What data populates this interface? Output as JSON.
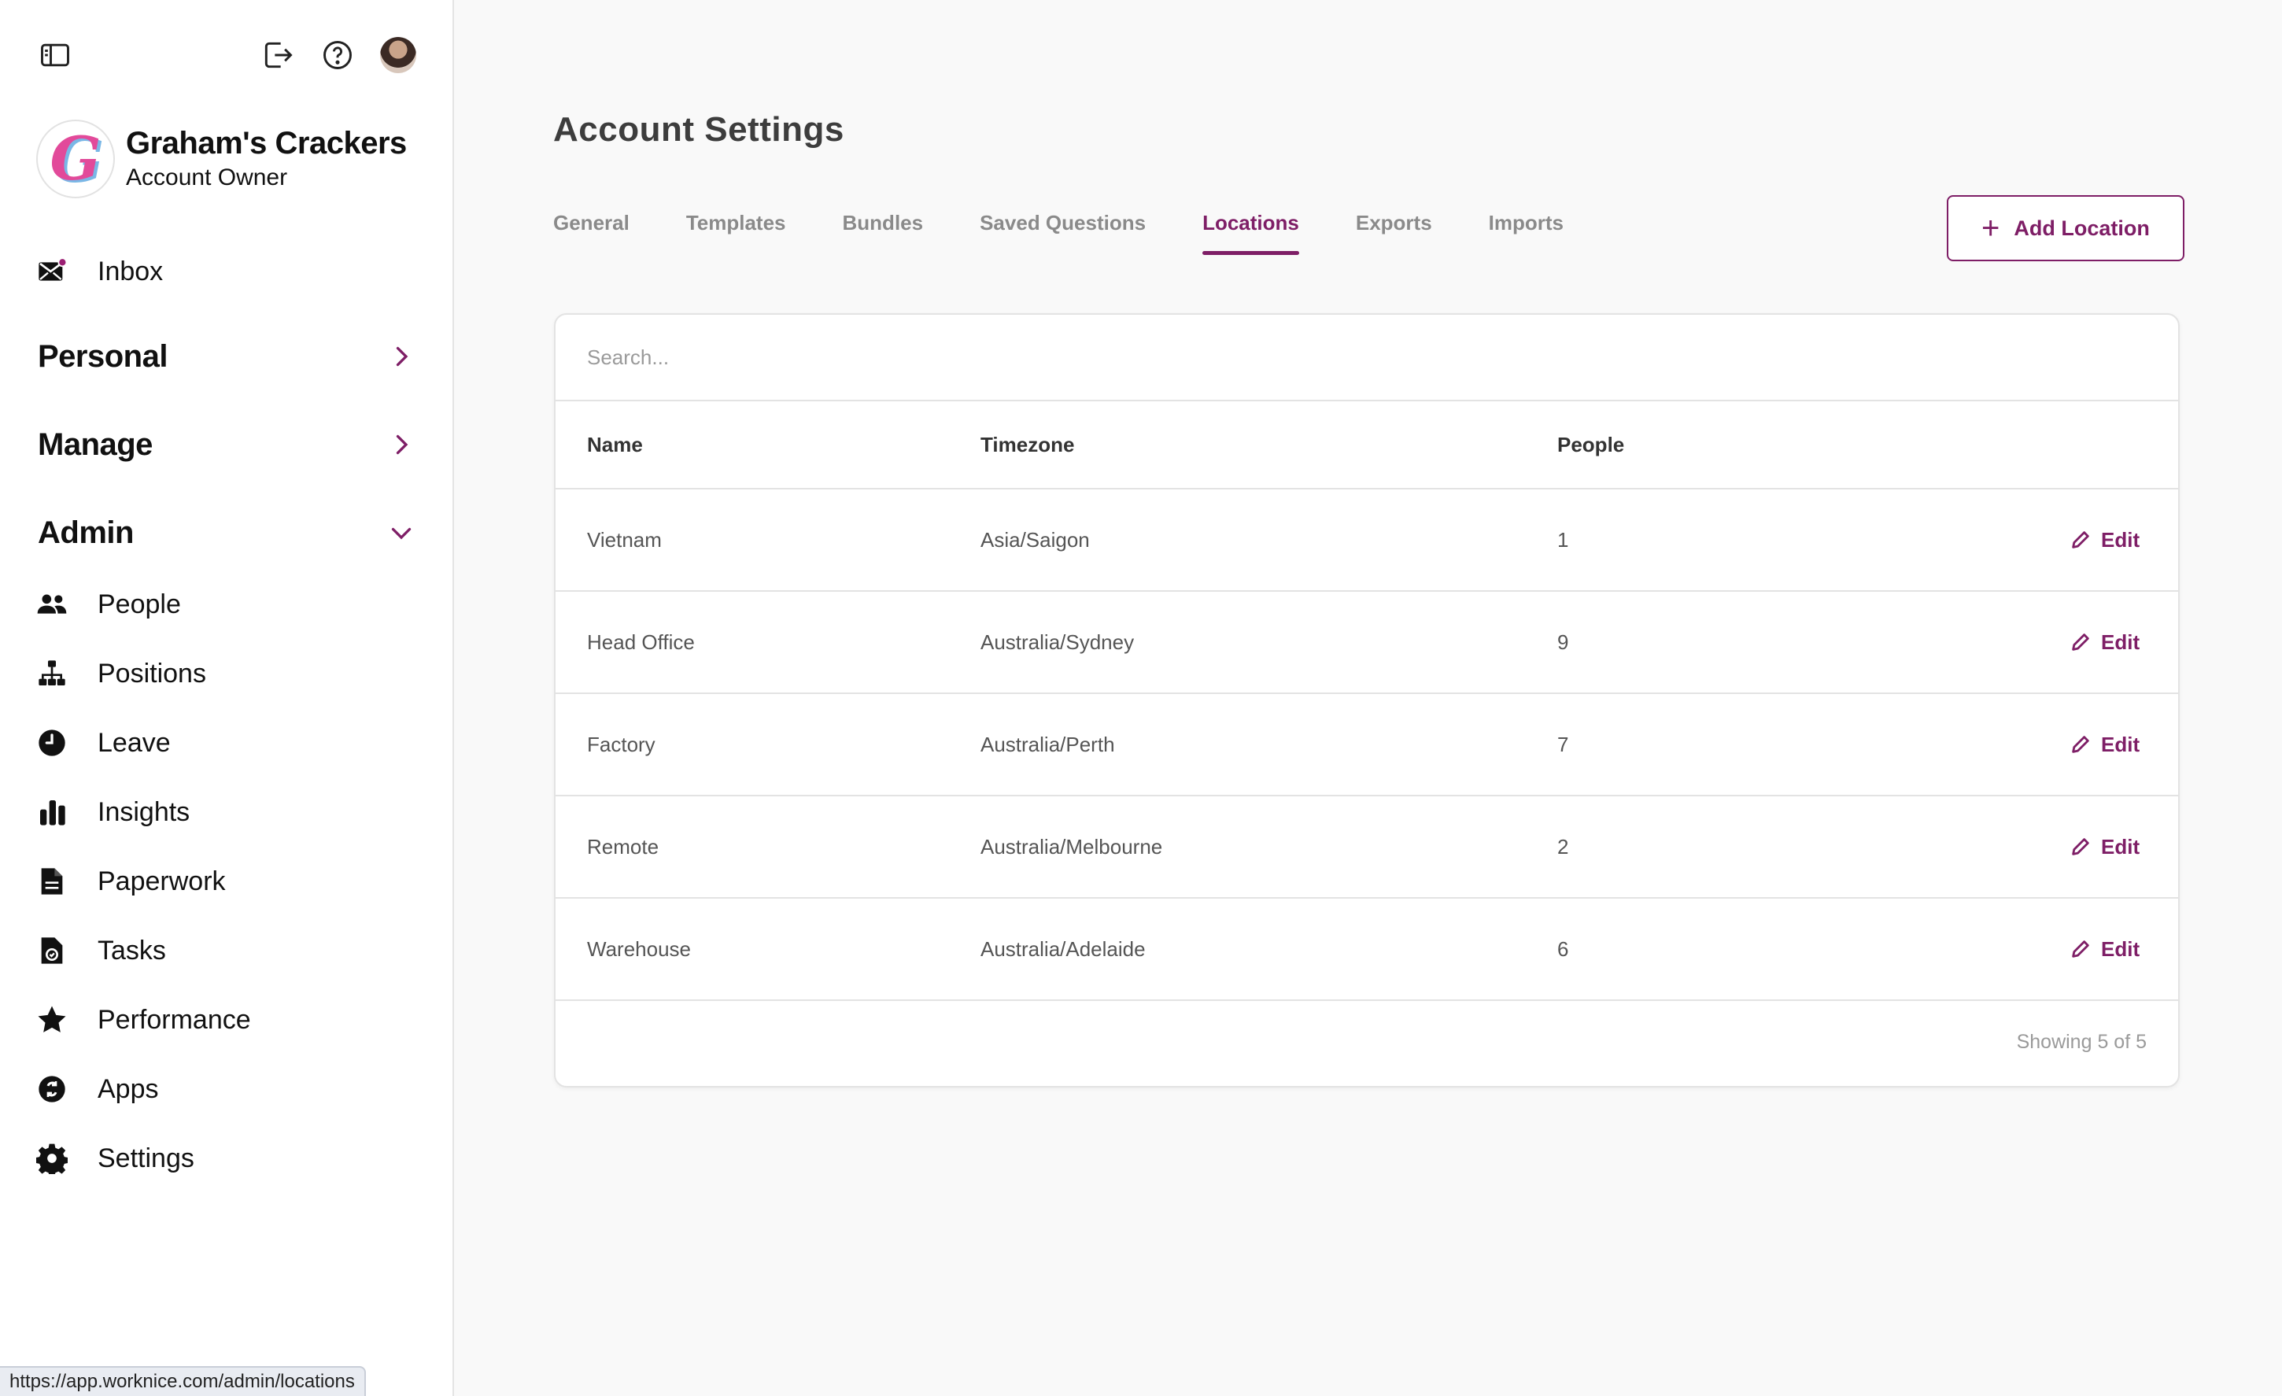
{
  "statusbar": {
    "url": "https://app.worknice.com/admin/locations"
  },
  "account": {
    "name": "Graham's Crackers",
    "role": "Account Owner",
    "logo_letter": "G"
  },
  "sidebar": {
    "inbox": "Inbox",
    "sections": {
      "personal": "Personal",
      "manage": "Manage",
      "admin": "Admin"
    },
    "admin_items": [
      {
        "label": "People",
        "icon": "people-icon"
      },
      {
        "label": "Positions",
        "icon": "org-chart-icon"
      },
      {
        "label": "Leave",
        "icon": "clock-icon"
      },
      {
        "label": "Insights",
        "icon": "bar-chart-icon"
      },
      {
        "label": "Paperwork",
        "icon": "document-icon"
      },
      {
        "label": "Tasks",
        "icon": "task-file-icon"
      },
      {
        "label": "Performance",
        "icon": "star-icon"
      },
      {
        "label": "Apps",
        "icon": "apps-icon"
      },
      {
        "label": "Settings",
        "icon": "gear-icon"
      }
    ]
  },
  "main": {
    "title": "Account Settings",
    "tabs": [
      "General",
      "Templates",
      "Bundles",
      "Saved Questions",
      "Locations",
      "Exports",
      "Imports"
    ],
    "active_tab": "Locations",
    "add_button": "Add Location",
    "search_placeholder": "Search...",
    "columns": {
      "name": "Name",
      "timezone": "Timezone",
      "people": "People"
    },
    "rows": [
      {
        "name": "Vietnam",
        "timezone": "Asia/Saigon",
        "people": "1",
        "action": "Edit"
      },
      {
        "name": "Head Office",
        "timezone": "Australia/Sydney",
        "people": "9",
        "action": "Edit"
      },
      {
        "name": "Factory",
        "timezone": "Australia/Perth",
        "people": "7",
        "action": "Edit"
      },
      {
        "name": "Remote",
        "timezone": "Australia/Melbourne",
        "people": "2",
        "action": "Edit"
      },
      {
        "name": "Warehouse",
        "timezone": "Australia/Adelaide",
        "people": "6",
        "action": "Edit"
      }
    ],
    "footer": "Showing 5 of 5"
  },
  "colors": {
    "accent": "#7e1e66",
    "background": "#f9f9f9",
    "border": "#e3e3e3"
  }
}
